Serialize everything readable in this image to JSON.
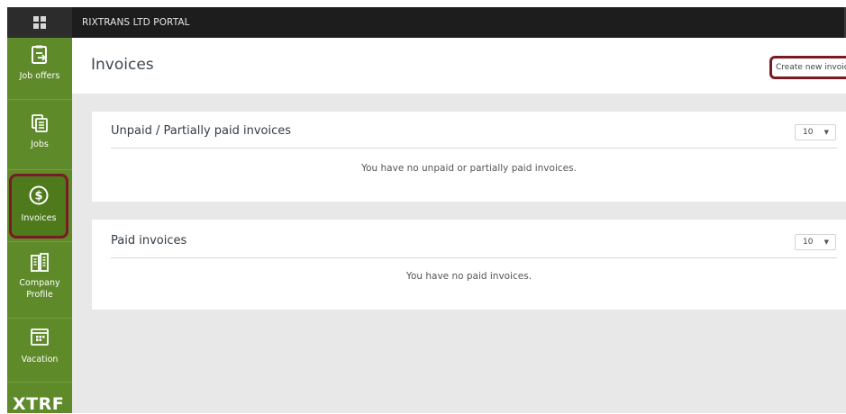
{
  "topbar": {
    "portal_title": "RIXTRANS LTD PORTAL"
  },
  "sidebar": {
    "items": [
      {
        "label": "Job offers",
        "icon": "job-offers-icon"
      },
      {
        "label": "Jobs",
        "icon": "jobs-icon"
      },
      {
        "label": "Invoices",
        "icon": "dollar-circle-icon",
        "active": true
      },
      {
        "label": "Company\nProfile",
        "label_line1": "Company",
        "label_line2": "Profile",
        "icon": "company-profile-icon"
      },
      {
        "label": "Vacation",
        "icon": "calendar-icon"
      }
    ],
    "logo": "XTRF"
  },
  "page": {
    "title": "Invoices",
    "create_button": "Create new invoice"
  },
  "panels": {
    "unpaid": {
      "title": "Unpaid / Partially paid invoices",
      "page_size": "10",
      "empty_message": "You have no unpaid or partially paid invoices."
    },
    "paid": {
      "title": "Paid invoices",
      "page_size": "10",
      "empty_message": "You have no paid invoices."
    }
  },
  "colors": {
    "sidebar": "#5f8a2a",
    "sidebar_active": "#4e7a1c",
    "highlight_border": "#7a1a24",
    "topbar": "#1d1d1d",
    "main_bg": "#e8e8e8"
  }
}
